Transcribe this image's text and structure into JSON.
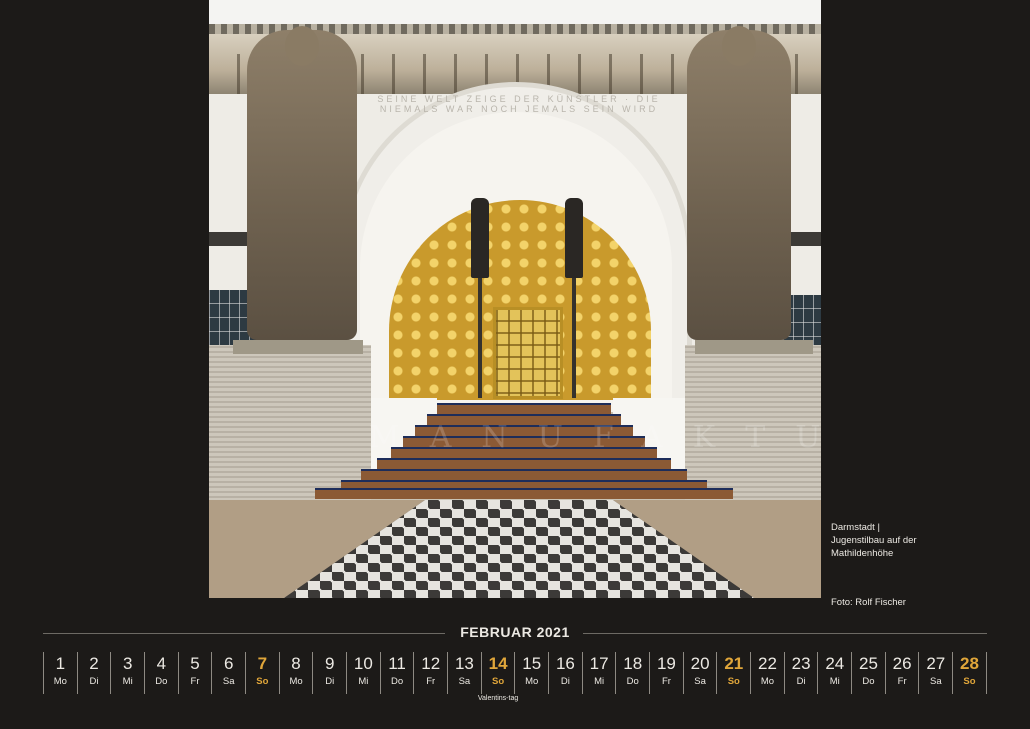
{
  "photo": {
    "inscription": "SEINE WELT ZEIGE DER KÜNSTLER · DIE NIEMALS WAR NOCH JEMALS SEIN WIRD",
    "watermark": "MANUFAKTUR"
  },
  "caption": {
    "line1": "Darmstadt |",
    "line2": "Jugenstilbau auf der",
    "line3": "Mathildenhöhe",
    "credit": "Foto: Rolf Fischer"
  },
  "calendar": {
    "title": "FEBRUAR 2021",
    "accent_color": "#e0a63a",
    "days": [
      {
        "num": "1",
        "wd": "Mo"
      },
      {
        "num": "2",
        "wd": "Di"
      },
      {
        "num": "3",
        "wd": "Mi"
      },
      {
        "num": "4",
        "wd": "Do"
      },
      {
        "num": "5",
        "wd": "Fr"
      },
      {
        "num": "6",
        "wd": "Sa"
      },
      {
        "num": "7",
        "wd": "So"
      },
      {
        "num": "8",
        "wd": "Mo"
      },
      {
        "num": "9",
        "wd": "Di"
      },
      {
        "num": "10",
        "wd": "Mi"
      },
      {
        "num": "11",
        "wd": "Do"
      },
      {
        "num": "12",
        "wd": "Fr"
      },
      {
        "num": "13",
        "wd": "Sa"
      },
      {
        "num": "14",
        "wd": "So",
        "note": "Valentins-tag"
      },
      {
        "num": "15",
        "wd": "Mo"
      },
      {
        "num": "16",
        "wd": "Di"
      },
      {
        "num": "17",
        "wd": "Mi"
      },
      {
        "num": "18",
        "wd": "Do"
      },
      {
        "num": "19",
        "wd": "Fr"
      },
      {
        "num": "20",
        "wd": "Sa"
      },
      {
        "num": "21",
        "wd": "So"
      },
      {
        "num": "22",
        "wd": "Mo"
      },
      {
        "num": "23",
        "wd": "Di"
      },
      {
        "num": "24",
        "wd": "Mi"
      },
      {
        "num": "25",
        "wd": "Do"
      },
      {
        "num": "26",
        "wd": "Fr"
      },
      {
        "num": "27",
        "wd": "Sa"
      },
      {
        "num": "28",
        "wd": "So"
      }
    ]
  }
}
